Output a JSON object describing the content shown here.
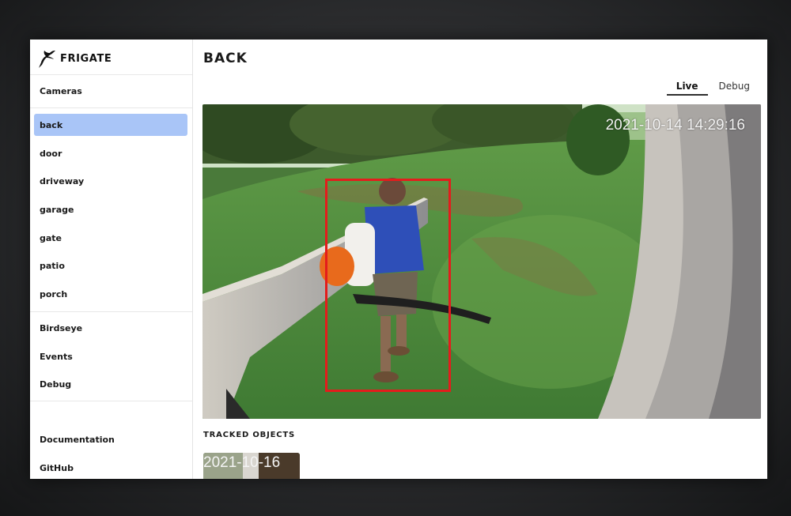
{
  "app": {
    "name": "FRIGATE"
  },
  "sidebar": {
    "cameras_heading": "Cameras",
    "cameras": [
      {
        "label": "back",
        "active": true
      },
      {
        "label": "door"
      },
      {
        "label": "driveway"
      },
      {
        "label": "garage"
      },
      {
        "label": "gate"
      },
      {
        "label": "patio"
      },
      {
        "label": "porch"
      }
    ],
    "sections": [
      {
        "label": "Birdseye"
      },
      {
        "label": "Events"
      },
      {
        "label": "Debug"
      }
    ],
    "links": [
      {
        "label": "Documentation"
      },
      {
        "label": "GitHub"
      }
    ]
  },
  "page": {
    "title": "BACK"
  },
  "tabs": [
    {
      "label": "Live",
      "active": true
    },
    {
      "label": "Debug"
    }
  ],
  "feed": {
    "timestamp": "2021-10-14 14:29:16",
    "detection_color": "#e41c1c"
  },
  "tracked_objects": {
    "heading": "TRACKED OBJECTS",
    "thumbnail_timestamp": "2021-10-16"
  },
  "colors": {
    "active_nav": "#a9c5f7"
  }
}
